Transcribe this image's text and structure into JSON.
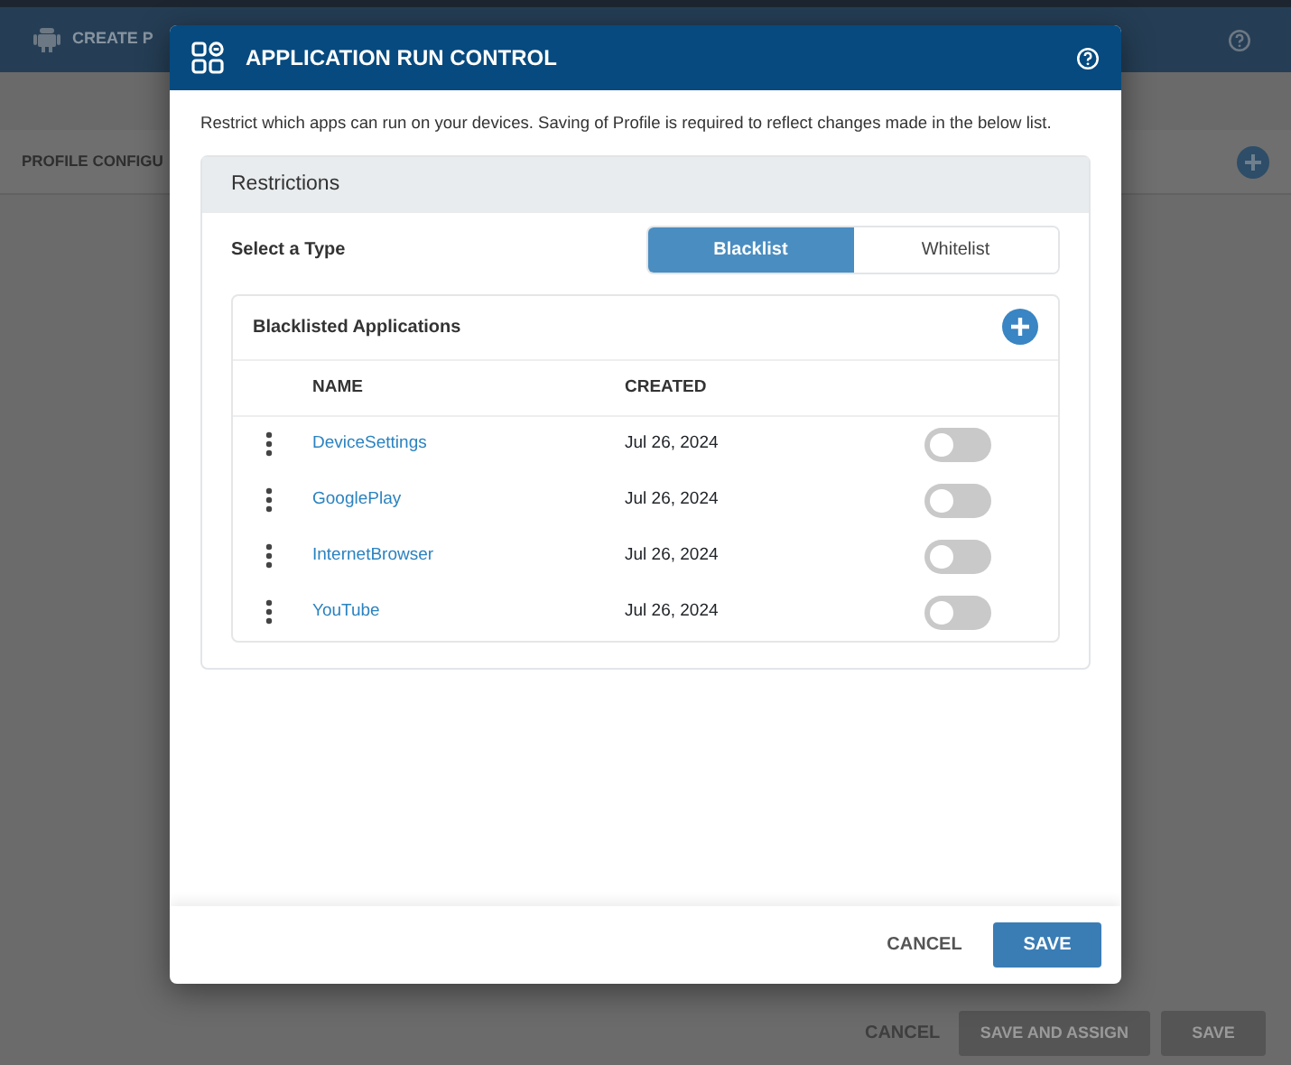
{
  "background": {
    "title": "CREATE P",
    "section": "PROFILE CONFIGU",
    "buttons": [
      {
        "label": "CANCEL",
        "kind": "link"
      },
      {
        "label": "SAVE AND ASSIGN",
        "kind": "solid"
      },
      {
        "label": "SAVE",
        "kind": "solid"
      }
    ]
  },
  "dialog": {
    "title": "APPLICATION RUN CONTROL",
    "description": "Restrict which apps can run on your devices. Saving of Profile is required to reflect changes made in the below list.",
    "panel_title": "Restrictions",
    "type_label": "Select a Type",
    "types": [
      {
        "label": "Blacklist",
        "selected": true
      },
      {
        "label": "Whitelist",
        "selected": false
      }
    ],
    "list_title": "Blacklisted Applications",
    "columns": [
      "NAME",
      "CREATED"
    ],
    "rows": [
      {
        "name": "DeviceSettings",
        "created": "Jul 26, 2024",
        "on": false
      },
      {
        "name": "GooglePlay",
        "created": "Jul 26, 2024",
        "on": false
      },
      {
        "name": "InternetBrowser",
        "created": "Jul 26, 2024",
        "on": false
      },
      {
        "name": "YouTube",
        "created": "Jul 26, 2024",
        "on": false
      }
    ],
    "buttons": [
      {
        "label": "CANCEL",
        "kind": "link"
      },
      {
        "label": "SAVE",
        "kind": "solid"
      }
    ]
  }
}
